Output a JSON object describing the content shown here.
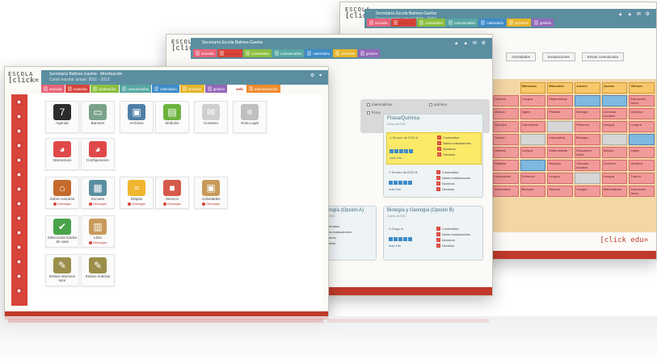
{
  "brand": {
    "logo_line1": "ESCOLA",
    "logo_line2": "[click=",
    "edu_logo": "[click edu="
  },
  "back_window": {
    "title": "Secretaría Escola Balmes-Gaviria",
    "subtitle": "Curso escolar actual: 2011 - 2012",
    "tabs": [
      {
        "label": "escuela",
        "color": "#e8647a"
      },
      {
        "label": "materias",
        "color": "#d9443a"
      },
      {
        "label": "contenidos",
        "color": "#8cbf3f"
      },
      {
        "label": "comunicados",
        "color": "#57a8a3"
      },
      {
        "label": "calendario",
        "color": "#3d8bc9"
      },
      {
        "label": "archivos",
        "color": "#e5b52c"
      },
      {
        "label": "gestión",
        "color": "#9467b8"
      }
    ],
    "breadcrumb": "Volver a materias",
    "buttons": [
      "Actividades",
      "Evaluaciones",
      "Enviar comunicado"
    ],
    "timetable_headers": [
      "Miércoles",
      "Jueves",
      "Viernes"
    ],
    "timetable_cells": [
      "Historia",
      "Lengua",
      "Matemáticas",
      "Educación física",
      "Música",
      "Inglés",
      "Plástica",
      "Biología",
      "Ciencias sociales",
      "Química",
      "Química",
      "Laboratorio",
      "Refuerzo",
      "Lengua",
      "Lengua",
      "Tutoría",
      "Informática",
      "Biología"
    ]
  },
  "middle_window": {
    "title": "Secretaría Escola Balmes-Gaviria",
    "tabs": [
      {
        "label": "escuela",
        "color": "#e8647a"
      },
      {
        "label": "materias",
        "color": "#d9443a"
      },
      {
        "label": "contenidos",
        "color": "#8cbf3f"
      },
      {
        "label": "comunicados",
        "color": "#57a8a3"
      },
      {
        "label": "calendario",
        "color": "#3d8bc9"
      },
      {
        "label": "archivos",
        "color": "#e5b52c"
      },
      {
        "label": "gestión",
        "color": "#9467b8"
      }
    ],
    "filters": [
      "matemáticas",
      "física",
      "química",
      "Ámbito de investigación"
    ],
    "cards": [
      {
        "title": "Física/Química",
        "subtitle": "Curso de ESO",
        "group_a": "1 Tercero de ESO A",
        "group_b": "1 Tercero de ESO B"
      },
      {
        "title": "Biología y Geología (Opción B)",
        "subtitle": "Cuarto de ESO",
        "group_a": "1 Grupo A",
        "group_b": ""
      },
      {
        "title": "Tecnología (Opción A)",
        "subtitle": "Cuarto de ESO",
        "group_a": "",
        "group_b": ""
      }
    ],
    "links": [
      "Contenidos",
      "Notas evaluaciones",
      "Alumnos",
      "Horarios"
    ],
    "more_info": "más info"
  },
  "front_window": {
    "title": "Secretaría Balmes-Gaviria · Movilización",
    "subtitle": "Curso escolar actual: 2011 - 2012",
    "tabs": [
      {
        "label": "escuela",
        "color": "#e8647a"
      },
      {
        "label": "materias",
        "color": "#d9443a"
      },
      {
        "label": "contenidos",
        "color": "#8cbf3f"
      },
      {
        "label": "comunicados",
        "color": "#57a8a3"
      },
      {
        "label": "calendario",
        "color": "#3d8bc9"
      },
      {
        "label": "archivos",
        "color": "#e5b52c"
      },
      {
        "label": "gestión",
        "color": "#9467b8"
      },
      {
        "label": "web",
        "color": "#ffffff"
      },
      {
        "label": "administración",
        "color": "#ef8b2c"
      }
    ],
    "tiles": [
      {
        "label": "Agenda",
        "icon": "calendar-icon",
        "glyph": "7",
        "downloads": ""
      },
      {
        "label": "Banners",
        "icon": "banner-icon",
        "glyph": "▭",
        "downloads": ""
      },
      {
        "label": "Archivos",
        "icon": "archive-box-icon",
        "glyph": "▣",
        "downloads": ""
      },
      {
        "label": "Módulos",
        "icon": "book-icon",
        "glyph": "▤",
        "downloads": ""
      },
      {
        "label": "Contacto",
        "icon": "envelope-icon",
        "glyph": "✉",
        "downloads": ""
      },
      {
        "label": "Nota Legal",
        "icon": "document-icon",
        "glyph": "≡",
        "downloads": ""
      },
      {
        "label": "Interactivos",
        "icon": "color-wheel-icon",
        "glyph": "◕",
        "downloads": ""
      },
      {
        "label": "Configuración",
        "icon": "settings-wheel-icon",
        "glyph": "◕",
        "downloads": ""
      },
      {
        "label": "Sobre nosotros",
        "icon": "house-icon",
        "glyph": "⌂",
        "downloads": "Descargas"
      },
      {
        "label": "Escuela",
        "icon": "building-icon",
        "glyph": "▦",
        "downloads": "Descargas"
      },
      {
        "label": "Etapas",
        "icon": "stages-icon",
        "glyph": "≈",
        "downloads": "Descargas"
      },
      {
        "label": "Servicio",
        "icon": "cubes-icon",
        "glyph": "■",
        "downloads": "Descargas"
      },
      {
        "label": "Actividades",
        "icon": "box-icon",
        "glyph": "▣",
        "downloads": "Descargas"
      },
      {
        "label": "Selecciona fondos de casa",
        "icon": "checkmark-icon",
        "glyph": "✔",
        "downloads": ""
      },
      {
        "label": "Libro",
        "icon": "package-icon",
        "glyph": "▥",
        "downloads": "Descargas"
      },
      {
        "label": "Enlace alumnos tutor",
        "icon": "map-pen-icon",
        "glyph": "✎",
        "downloads": ""
      },
      {
        "label": "Enlace noticias",
        "icon": "map-pen-icon",
        "glyph": "✎",
        "downloads": ""
      }
    ],
    "glyph_colors": [
      "#2c2c2c",
      "#7aa38a",
      "#4f7fa6",
      "#6db33f",
      "#cfcfcf",
      "#bfbfbf",
      "#e0494a",
      "#e0494a",
      "#c46a2b",
      "#5b8ea0",
      "#f0b62f",
      "#d45a4a",
      "#c79a5a",
      "#49a34a",
      "#c79a5a",
      "#9a8f4a",
      "#9a8f4a"
    ]
  }
}
